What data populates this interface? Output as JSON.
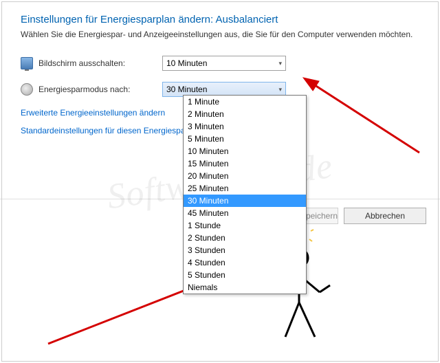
{
  "title": "Einstellungen für Energiesparplan ändern: Ausbalanciert",
  "subtitle": "Wählen Sie die Energiespar- und Anzeigeeinstellungen aus, die Sie für den Computer verwenden möchten.",
  "settings": {
    "display_off": {
      "label": "Bildschirm ausschalten:",
      "value": "10 Minuten"
    },
    "sleep": {
      "label": "Energiesparmodus nach:",
      "value": "30 Minuten"
    }
  },
  "dropdown_options": [
    "1 Minute",
    "2 Minuten",
    "3 Minuten",
    "5 Minuten",
    "10 Minuten",
    "15 Minuten",
    "20 Minuten",
    "25 Minuten",
    "30 Minuten",
    "45 Minuten",
    "1 Stunde",
    "2 Stunden",
    "3 Stunden",
    "4 Stunden",
    "5 Stunden",
    "Niemals"
  ],
  "dropdown_selected_index": 8,
  "links": {
    "advanced": "Erweiterte Energieeinstellungen ändern",
    "restore": "Standardeinstellungen für diesen Energiesparplan wiederherstellen"
  },
  "buttons": {
    "save": "Änderungen speichern",
    "cancel": "Abbrechen"
  },
  "watermark": "SoftwareOK.de"
}
